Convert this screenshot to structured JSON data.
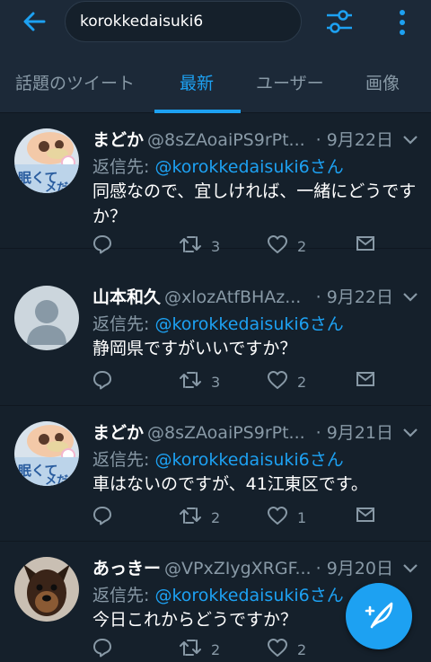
{
  "search": {
    "query": "korokkedaisuki6"
  },
  "tabs": [
    {
      "label": "話題のツイート"
    },
    {
      "label": "最新"
    },
    {
      "label": "ユーザー"
    },
    {
      "label": "画像"
    }
  ],
  "active_tab": "最新",
  "colors": {
    "accent": "#1da1f2",
    "background": "#15202b",
    "bar": "#1c2938",
    "muted": "#8899a6"
  },
  "tweets": [
    {
      "name": "まどか",
      "handle": "@8sZAoaiPS9rPt...",
      "date": "· 9月22日",
      "reply_label": "返信先:",
      "reply_to": "@korokkedaisuki6さん",
      "text": "同感なので、宜しければ、一緒にどうですか？",
      "retweets": "3",
      "likes": "2",
      "avatar": "anime-avatar"
    },
    {
      "name": "山本和久",
      "handle": "@xlozAtfBHAz...",
      "date": "· 9月22日",
      "reply_label": "返信先:",
      "reply_to": "@korokkedaisuki6さん",
      "text": "静岡県ですがいいですか？",
      "retweets": "3",
      "likes": "2",
      "avatar": "default-avatar"
    },
    {
      "name": "まどか",
      "handle": "@8sZAoaiPS9rPt...",
      "date": "· 9月21日",
      "reply_label": "返信先:",
      "reply_to": "@korokkedaisuki6さん",
      "text": "車はないのですが、41江東区です。",
      "retweets": "2",
      "likes": "1",
      "avatar": "anime-avatar"
    },
    {
      "name": "あっきー",
      "handle": "@VPxZIygXRGF...",
      "date": "· 9月20日",
      "reply_label": "返信先:",
      "reply_to": "@korokkedaisuki6さん",
      "text": "今日これからどうですか？",
      "retweets": "2",
      "likes": "2",
      "avatar": "dog-avatar"
    }
  ]
}
